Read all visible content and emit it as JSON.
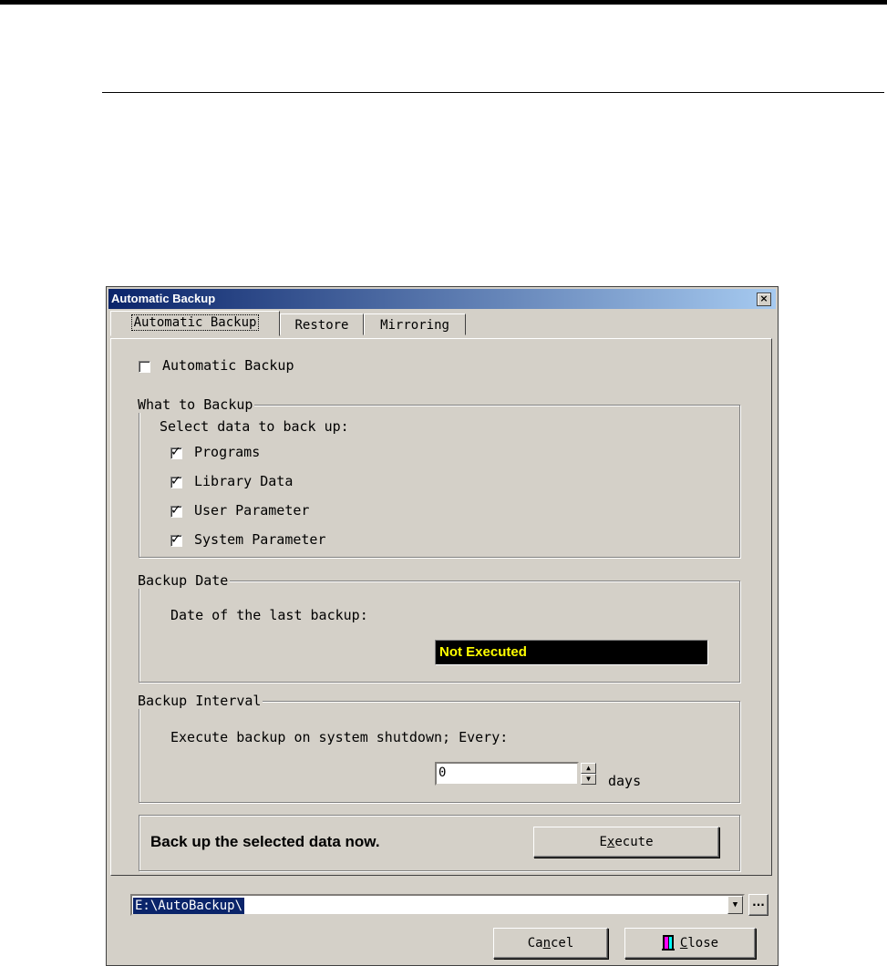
{
  "window": {
    "title": "Automatic Backup",
    "close_glyph": "×"
  },
  "tabs": [
    {
      "label": "Automatic Backup",
      "active": true
    },
    {
      "label": "Restore",
      "active": false
    },
    {
      "label": "Mirroring",
      "active": false
    }
  ],
  "auto_backup": {
    "label": "Automatic Backup",
    "checked": false
  },
  "what_to_backup": {
    "legend": "What to Backup",
    "prompt": "Select data to back up:",
    "items": [
      {
        "label": "Programs",
        "checked": true
      },
      {
        "label": "Library Data",
        "checked": true
      },
      {
        "label": "User Parameter",
        "checked": true
      },
      {
        "label": "System Parameter",
        "checked": true
      }
    ]
  },
  "backup_date": {
    "legend": "Backup Date",
    "label": "Date of the last backup:",
    "value": "Not Executed",
    "colors": {
      "background": "#000000",
      "text": "#ffff00"
    }
  },
  "backup_interval": {
    "legend": "Backup Interval",
    "label": "Execute backup on system shutdown; Every:",
    "value": "0",
    "unit": "days"
  },
  "execute_section": {
    "message": "Back up the selected data now.",
    "button_pre": "E",
    "button_underline": "x",
    "button_post": "ecute"
  },
  "path": {
    "value": "E:\\AutoBackup\\",
    "browse_label": "..."
  },
  "footer": {
    "cancel_pre": "Ca",
    "cancel_underline": "n",
    "cancel_post": "cel",
    "close_underline": "C",
    "close_post": "lose",
    "close_icon": "door-icon"
  },
  "colors": {
    "titlebar_start": "#0a246a",
    "titlebar_end": "#a6caf0",
    "face": "#d4d0c8"
  }
}
